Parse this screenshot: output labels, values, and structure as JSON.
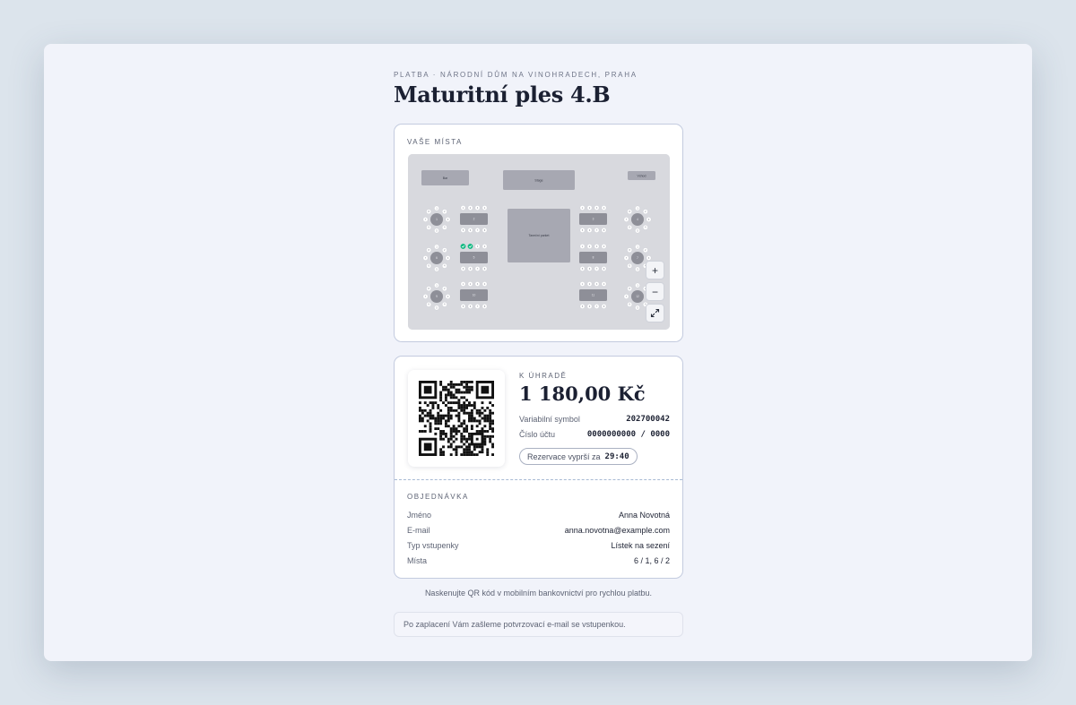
{
  "page": {
    "kicker": "PLATBA · NÁRODNÍ DŮM NA VINOHRADECH, PRAHA",
    "title": "Maturitní ples 4.B"
  },
  "seats": {
    "section_label": "VAŠE MÍSTA",
    "map": {
      "labels": {
        "bar": "Bar",
        "stage": "Stage",
        "entrance": "Vchod",
        "dance_floor": "Taneční parket"
      },
      "round_tables": [
        "1",
        "4",
        "6",
        "7",
        "9",
        "12"
      ],
      "long_tables": [
        "2",
        "3",
        "5",
        "8",
        "10",
        "11"
      ],
      "seat_numbers": [
        "1",
        "2",
        "3",
        "4",
        "5",
        "6",
        "7",
        "8"
      ],
      "selected_table": "5",
      "selected_seats": [
        "1",
        "2"
      ],
      "colors": {
        "selected": "#10b981",
        "table": "#8e8f98",
        "seat": "#ffffff",
        "floor": "#d8d9de"
      }
    },
    "controls": {
      "zoom_in": "+",
      "zoom_out": "−",
      "fullscreen_icon": "expand-icon"
    }
  },
  "payment": {
    "due_label": "K ÚHRADĚ",
    "amount": "1 180,00 Kč",
    "variable_symbol_label": "Variabilní symbol",
    "variable_symbol": "202700042",
    "account_label": "Číslo účtu",
    "account": "0000000000 / 0000",
    "timer_label": "Rezervace vyprší za",
    "timer": "29:40"
  },
  "order": {
    "section_label": "OBJEDNÁVKA",
    "rows": [
      {
        "label": "Jméno",
        "value": "Anna Novotná"
      },
      {
        "label": "E-mail",
        "value": "anna.novotna@example.com"
      },
      {
        "label": "Typ vstupenky",
        "value": "Lístek na sezení"
      },
      {
        "label": "Místa",
        "value": "6 / 1, 6 / 2"
      }
    ]
  },
  "hint": "Naskenujte QR kód v mobilním bankovnictví pro rychlou platbu.",
  "notice": "Po zaplacení Vám zašleme potvrzovací e-mail se vstupenkou."
}
